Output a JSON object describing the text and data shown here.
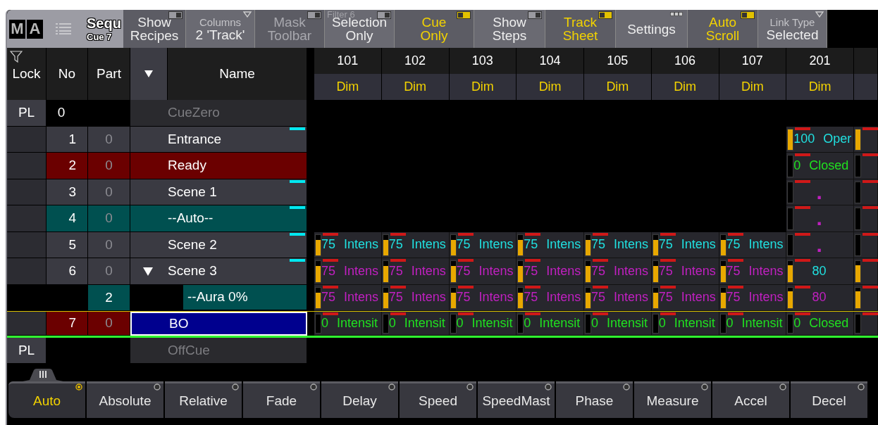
{
  "toolbar": {
    "logo": [
      "M",
      "A"
    ],
    "title": "Sequ",
    "subtitle": "Cue 7",
    "buttons": [
      {
        "kind": "toggle",
        "label": "Show Recipes",
        "on": false,
        "disabled": false
      },
      {
        "kind": "dropdown",
        "caption": "Columns",
        "value": "2 'Track'"
      },
      {
        "kind": "toggle",
        "label": "Mask Toolbar",
        "on": false,
        "disabled": true
      },
      {
        "kind": "toggle",
        "caption": "Filter 6",
        "label": "Selection Only",
        "on": false,
        "disabled": false
      },
      {
        "kind": "toggle",
        "label": "Cue Only",
        "on": true,
        "disabled": false
      },
      {
        "kind": "toggle",
        "label": "Show Steps",
        "on": false,
        "disabled": false
      },
      {
        "kind": "toggle",
        "label": "Track Sheet",
        "on": true,
        "disabled": false
      },
      {
        "kind": "menu",
        "label": "Settings"
      },
      {
        "kind": "toggle",
        "label": "Auto Scroll",
        "on": true,
        "disabled": false
      },
      {
        "kind": "dropdown",
        "caption": "Link Type",
        "value": "Selected"
      }
    ]
  },
  "columns": {
    "lock": "Lock",
    "no": "No",
    "part": "Part",
    "name": "Name"
  },
  "fixtures": [
    {
      "id": "101",
      "attribute": "Dim"
    },
    {
      "id": "102",
      "attribute": "Dim"
    },
    {
      "id": "103",
      "attribute": "Dim"
    },
    {
      "id": "104",
      "attribute": "Dim"
    },
    {
      "id": "105",
      "attribute": "Dim"
    },
    {
      "id": "106",
      "attribute": "Dim"
    },
    {
      "id": "107",
      "attribute": "Dim"
    },
    {
      "id": "201",
      "attribute": "Dim"
    }
  ],
  "rows": [
    {
      "kind": "virtual",
      "lock": "PL",
      "no": "0",
      "name": "CueZero",
      "selected": false,
      "current": false,
      "cells": [
        null,
        null,
        null,
        null,
        null,
        null,
        null,
        null,
        null
      ]
    },
    {
      "kind": "cue",
      "no": "1",
      "part": "0",
      "name": "Entrance",
      "marker": true,
      "selected": false,
      "current": false,
      "cells": [
        null,
        null,
        null,
        null,
        null,
        null,
        null,
        {
          "level": 1,
          "value": "100",
          "attribute": "Oper",
          "color": "#20e0e0"
        },
        {
          "level": 1
        }
      ]
    },
    {
      "kind": "cue",
      "no": "2",
      "part": "0",
      "name": "Ready",
      "color": "#6b0000",
      "marker": false,
      "selected": false,
      "current": false,
      "cells": [
        null,
        null,
        null,
        null,
        null,
        null,
        null,
        {
          "level": 0,
          "value": "0",
          "attribute": "Closed",
          "color": "#20e020"
        },
        {
          "level": 0
        }
      ]
    },
    {
      "kind": "cue",
      "no": "3",
      "part": "0",
      "name": "Scene 1",
      "marker": true,
      "selected": false,
      "current": false,
      "cells": [
        null,
        null,
        null,
        null,
        null,
        null,
        null,
        {
          "level": 0,
          "value": ".",
          "color": "#c020c0"
        },
        {
          "level": 0
        }
      ]
    },
    {
      "kind": "cue",
      "no": "4",
      "part": "0",
      "name": "--Auto--",
      "color": "#005050",
      "marker": true,
      "selected": false,
      "current": false,
      "cells": [
        null,
        null,
        null,
        null,
        null,
        null,
        null,
        {
          "level": 0,
          "value": ".",
          "color": "#c020c0"
        },
        {
          "level": 0
        }
      ]
    },
    {
      "kind": "cue",
      "no": "5",
      "part": "0",
      "name": "Scene 2",
      "marker": true,
      "selected": false,
      "current": false,
      "cells": [
        {
          "level": 0.75,
          "value": "75",
          "attribute": "Intens",
          "color": "#20e0e0"
        },
        {
          "level": 0.75,
          "value": "75",
          "attribute": "Intens",
          "color": "#20e0e0"
        },
        {
          "level": 0.75,
          "value": "75",
          "attribute": "Intens",
          "color": "#20e0e0"
        },
        {
          "level": 0.75,
          "value": "75",
          "attribute": "Intens",
          "color": "#20e0e0"
        },
        {
          "level": 0.75,
          "value": "75",
          "attribute": "Intens",
          "color": "#20e0e0"
        },
        {
          "level": 0.75,
          "value": "75",
          "attribute": "Intens",
          "color": "#20e0e0"
        },
        {
          "level": 0.75,
          "value": "75",
          "attribute": "Intens",
          "color": "#20e0e0"
        },
        {
          "level": 0,
          "value": ".",
          "color": "#c020c0"
        },
        {
          "level": 0
        }
      ]
    },
    {
      "kind": "cue",
      "no": "6",
      "part": "0",
      "name": "Scene 3",
      "marker": true,
      "expanded": true,
      "selected": false,
      "current": false,
      "cells": [
        {
          "level": 0.75,
          "value": "75",
          "attribute": "Intens",
          "color": "#c020c0"
        },
        {
          "level": 0.75,
          "value": "75",
          "attribute": "Intens",
          "color": "#c020c0"
        },
        {
          "level": 0.75,
          "value": "75",
          "attribute": "Intens",
          "color": "#c020c0"
        },
        {
          "level": 0.75,
          "value": "75",
          "attribute": "Intens",
          "color": "#c020c0"
        },
        {
          "level": 0.75,
          "value": "75",
          "attribute": "Intens",
          "color": "#c020c0"
        },
        {
          "level": 0.75,
          "value": "75",
          "attribute": "Intens",
          "color": "#c020c0"
        },
        {
          "level": 0.75,
          "value": "75",
          "attribute": "Intens",
          "color": "#c020c0"
        },
        {
          "level": 0.8,
          "value": "80",
          "color": "#20e0e0"
        },
        {
          "level": 0.8
        }
      ]
    },
    {
      "kind": "part",
      "part": "2",
      "name": "--Aura 0%",
      "color": "#005050",
      "selected": false,
      "current": false,
      "cells": [
        {
          "level": 0.75,
          "value": "75",
          "attribute": "Intens",
          "color": "#c020c0"
        },
        {
          "level": 0.75,
          "value": "75",
          "attribute": "Intens",
          "color": "#c020c0"
        },
        {
          "level": 0.75,
          "value": "75",
          "attribute": "Intens",
          "color": "#c020c0"
        },
        {
          "level": 0.75,
          "value": "75",
          "attribute": "Intens",
          "color": "#c020c0"
        },
        {
          "level": 0.75,
          "value": "75",
          "attribute": "Intens",
          "color": "#c020c0"
        },
        {
          "level": 0.75,
          "value": "75",
          "attribute": "Intens",
          "color": "#c020c0"
        },
        {
          "level": 0.75,
          "value": "75",
          "attribute": "Intens",
          "color": "#c020c0"
        },
        {
          "level": 0.8,
          "value": "80",
          "color": "#c020c0"
        },
        {
          "level": 0.8
        }
      ]
    },
    {
      "kind": "cue",
      "no": "7",
      "part": "0",
      "name": "BO",
      "color": "#6b0000",
      "marker": false,
      "selected": true,
      "current": true,
      "cells": [
        {
          "level": 0,
          "value": "0",
          "attribute": "Intensit",
          "color": "#20e020"
        },
        {
          "level": 0,
          "value": "0",
          "attribute": "Intensit",
          "color": "#20e020"
        },
        {
          "level": 0,
          "value": "0",
          "attribute": "Intensit",
          "color": "#20e020"
        },
        {
          "level": 0,
          "value": "0",
          "attribute": "Intensit",
          "color": "#20e020"
        },
        {
          "level": 0,
          "value": "0",
          "attribute": "Intensit",
          "color": "#20e020"
        },
        {
          "level": 0,
          "value": "0",
          "attribute": "Intensit",
          "color": "#20e020"
        },
        {
          "level": 0,
          "value": "0",
          "attribute": "Intensit",
          "color": "#20e020"
        },
        {
          "level": 0,
          "value": "0",
          "attribute": "Closed",
          "color": "#20e020"
        },
        {
          "level": 0
        }
      ]
    },
    {
      "kind": "virtual",
      "lock": "PL",
      "name": "OffCue",
      "selected": false,
      "current": false,
      "cells": [
        null,
        null,
        null,
        null,
        null,
        null,
        null,
        null,
        null
      ]
    }
  ],
  "modes": [
    {
      "label": "Auto",
      "selected": true
    },
    {
      "label": "Absolute",
      "selected": false
    },
    {
      "label": "Relative",
      "selected": false
    },
    {
      "label": "Fade",
      "selected": false
    },
    {
      "label": "Delay",
      "selected": false
    },
    {
      "label": "Speed",
      "selected": false
    },
    {
      "label": "SpeedMast",
      "selected": false
    },
    {
      "label": "Phase",
      "selected": false
    },
    {
      "label": "Measure",
      "selected": false
    },
    {
      "label": "Accel",
      "selected": false
    },
    {
      "label": "Decel",
      "selected": false
    }
  ]
}
